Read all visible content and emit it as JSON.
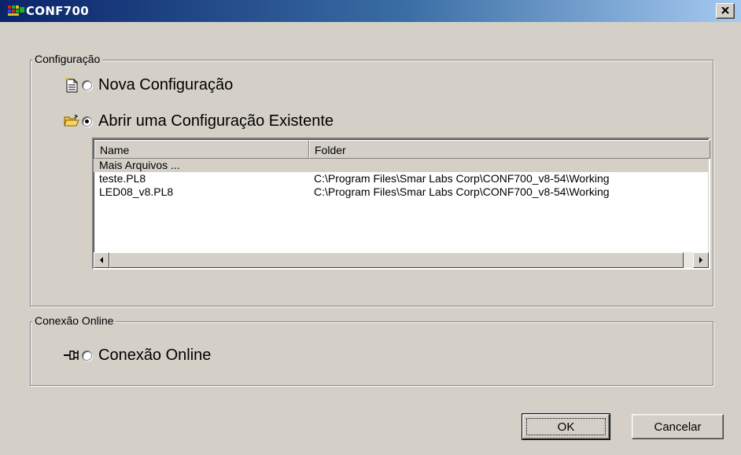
{
  "window": {
    "title": "CONF700"
  },
  "config_group": {
    "legend": "Configuração",
    "new_config_label": "Nova Configuração",
    "open_existing_label": "Abrir uma Configuração Existente",
    "selected_option": "open_existing"
  },
  "file_list": {
    "columns": [
      "Name",
      "Folder"
    ],
    "rows": [
      {
        "name": "Mais Arquivos ...",
        "folder": ""
      },
      {
        "name": "teste.PL8",
        "folder": "C:\\Program Files\\Smar Labs Corp\\CONF700_v8-54\\Working"
      },
      {
        "name": "LED08_v8.PL8",
        "folder": "C:\\Program Files\\Smar Labs Corp\\CONF700_v8-54\\Working"
      }
    ]
  },
  "online_group": {
    "legend": "Conexão Online",
    "online_label": "Conexão Online"
  },
  "buttons": {
    "ok_label": "OK",
    "cancel_label": "Cancelar"
  },
  "icons": {
    "app": "app-logo-icon",
    "close": "close-icon",
    "new_config": "new-document-icon",
    "open_existing": "open-folder-icon",
    "online": "plug-connection-icon",
    "scroll_left": "arrow-left-icon",
    "scroll_right": "arrow-right-icon"
  }
}
